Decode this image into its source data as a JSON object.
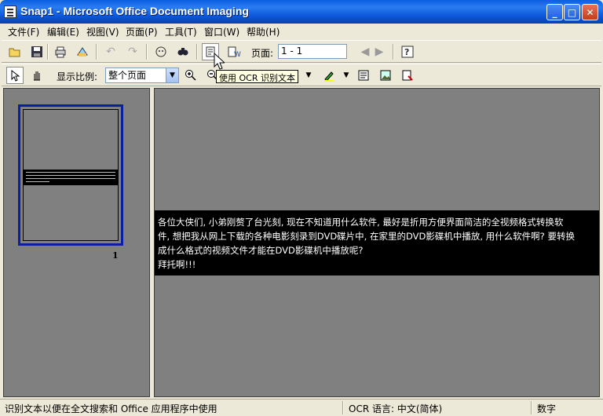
{
  "window": {
    "title": "Snap1 - Microsoft Office Document Imaging"
  },
  "menu": {
    "items": [
      "文件(F)",
      "编辑(E)",
      "视图(V)",
      "页面(P)",
      "工具(T)",
      "窗口(W)",
      "帮助(H)"
    ]
  },
  "toolbar1": {
    "page_label": "页面:",
    "page_value": "1 - 1"
  },
  "toolbar2": {
    "zoom_label": "显示比例:",
    "zoom_value": "整个页面",
    "tooltip": "使用 OCR 识别文本"
  },
  "thumbnail": {
    "page_number": "1"
  },
  "document": {
    "lines": [
      "各位大侠们, 小弟刚赘了台光刻, 现在不知道用什么软件, 最好是折用方便界面简洁的全视频格式转换软",
      "件, 想把我从网上下载的各种电影刻录到DVD碟片中, 在家里的DVD影碟机中播放, 用什么软件啊? 要转换",
      "成什么格式的视频文件才能在DVD影碟机中播放呢?",
      "拜托啊!!!"
    ]
  },
  "status": {
    "message": "识别文本以便在全文搜索和 Office 应用程序中使用",
    "ocr_language": "OCR 语言: 中文(简体)",
    "mode": "数字"
  },
  "icons": [
    "open-folder-icon",
    "save-icon",
    "print-icon",
    "send-icon",
    "undo-icon",
    "redo-icon",
    "reset-icon",
    "find-icon",
    "ocr-icon",
    "send-to-word-icon",
    "prev-page-icon",
    "next-page-icon",
    "help-icon",
    "select-arrow-icon",
    "pan-hand-icon",
    "zoom-in-icon",
    "zoom-out-icon",
    "highlighter-icon",
    "text-box-icon",
    "picture-icon",
    "annotation-icon"
  ]
}
